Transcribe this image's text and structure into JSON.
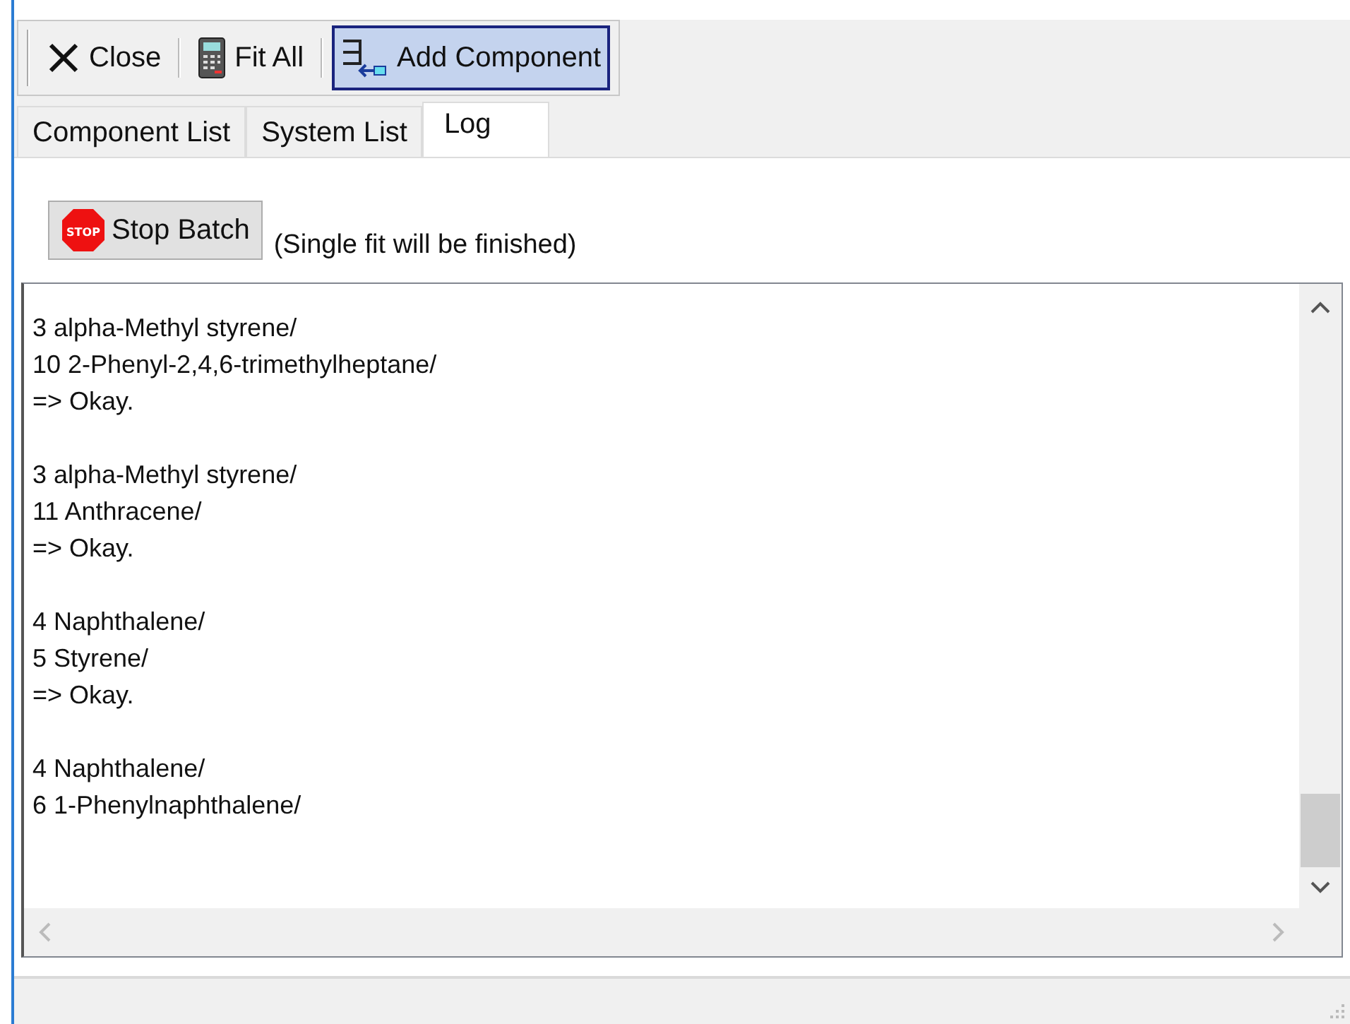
{
  "toolbar": [
    {
      "kind": "close",
      "label": "Close",
      "selected": false
    },
    {
      "kind": "calculator",
      "label": "Fit All",
      "selected": false
    },
    {
      "kind": "add",
      "label": "Add Component",
      "selected": true
    }
  ],
  "tabs": [
    {
      "label": "Component List",
      "selected": false
    },
    {
      "label": "System List",
      "selected": false
    },
    {
      "label": "Log",
      "selected": true
    }
  ],
  "stop_button": {
    "label": "Stop Batch",
    "icon_text": "STOP"
  },
  "stop_note": "(Single fit will be finished)",
  "log": [
    [
      "3 alpha-Methyl styrene/",
      "10 2-Phenyl-2,4,6-trimethylheptane/",
      "=> Okay."
    ],
    [
      "3 alpha-Methyl styrene/",
      "11 Anthracene/",
      "=> Okay."
    ],
    [
      "4 Naphthalene/",
      "5 Styrene/",
      "=> Okay."
    ],
    [
      "4 Naphthalene/",
      "6 1-Phenylnaphthalene/"
    ]
  ]
}
